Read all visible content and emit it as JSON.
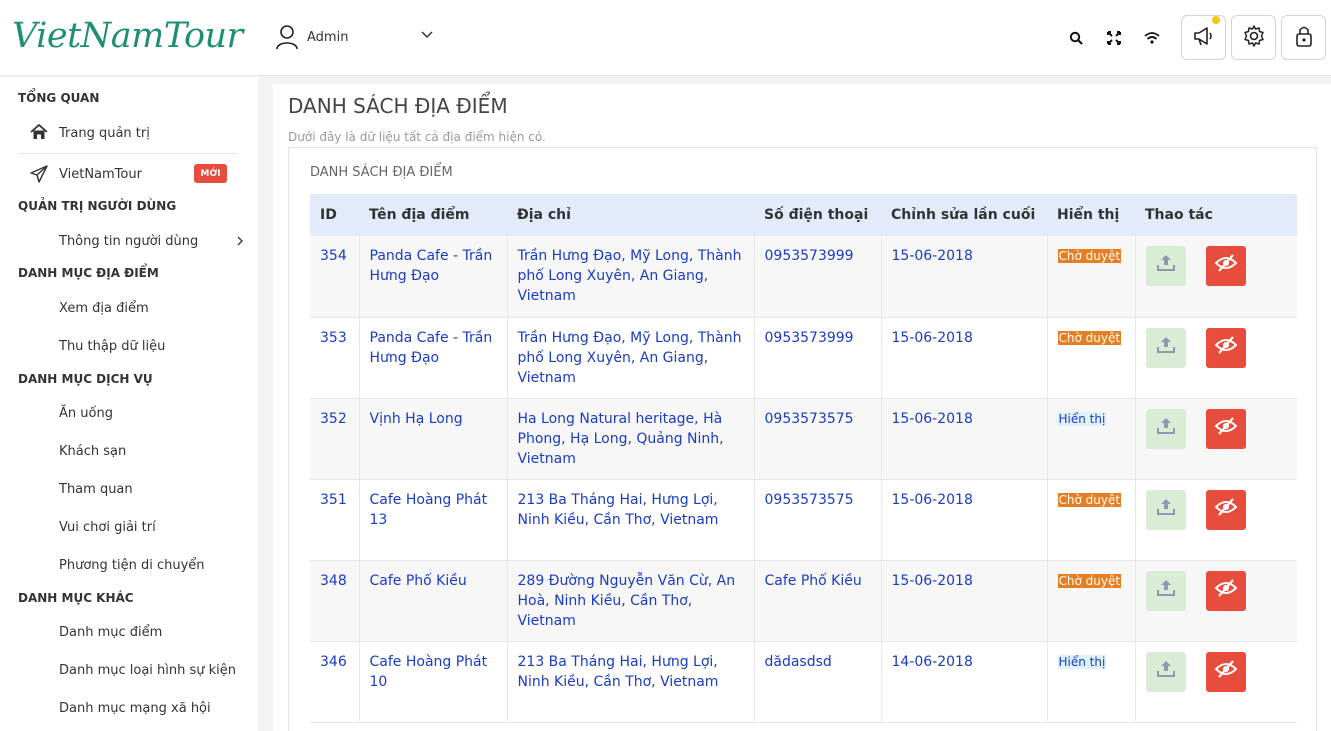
{
  "header": {
    "logo": "VietNamTour",
    "user_name": "Admin",
    "icons": [
      "search-icon",
      "fullscreen-icon",
      "wifi-icon",
      "megaphone-icon",
      "gear-icon",
      "lock-icon"
    ],
    "notification_color": "#f5c518"
  },
  "sidebar": {
    "sections": [
      {
        "title": "TỔNG QUAN"
      },
      {
        "title": "QUẢN TRỊ NGƯỜI DÙNG"
      },
      {
        "title": "DANH MỤC ĐỊA ĐIỂM"
      },
      {
        "title": "DANH MỤC DỊCH VỤ"
      },
      {
        "title": "DANH MỤC KHÁC"
      }
    ],
    "items": [
      {
        "label": "Trang quản trị",
        "icon": "home-icon"
      },
      {
        "label": "VietNamTour",
        "icon": "paper-plane-icon",
        "badge": "MỚI"
      },
      {
        "label": "Thông tin người dùng",
        "icon": "chevron-right-icon"
      },
      {
        "label": "Xem địa điểm"
      },
      {
        "label": "Thu thập dữ liệu"
      },
      {
        "label": "Ăn uống"
      },
      {
        "label": "Khách sạn"
      },
      {
        "label": "Tham quan"
      },
      {
        "label": "Vui chơi giải trí"
      },
      {
        "label": "Phương tiện di chuyển"
      },
      {
        "label": "Danh mục điểm"
      },
      {
        "label": "Danh mục loại hình sự kiện"
      },
      {
        "label": "Danh mục mạng xã hội"
      }
    ]
  },
  "main": {
    "title": "DANH SÁCH ĐỊA ĐIỂM",
    "subtitle": "Dưới đây là dữ liệu tất cả địa điểm hiện có.",
    "panel_title": "DANH SÁCH ĐỊA ĐIỂM",
    "columns": [
      "ID",
      "Tên địa điểm",
      "Địa chỉ",
      "Số điện thoại",
      "Chỉnh sửa lần cuối",
      "Hiển thị",
      "Thao tác"
    ],
    "rows": [
      {
        "id": "354",
        "name": "Panda Cafe - Trần Hưng Đạo",
        "address": "Trần Hưng Đạo, Mỹ Long, Thành phố Long Xuyên, An Giang, Vietnam",
        "phone": "0953573999",
        "updated": "15-06-2018",
        "status": "Chờ duyệt",
        "status_type": "pending"
      },
      {
        "id": "353",
        "name": "Panda Cafe - Trần Hưng Đạo",
        "address": "Trần Hưng Đạo, Mỹ Long, Thành phố Long Xuyên, An Giang, Vietnam",
        "phone": "0953573999",
        "updated": "15-06-2018",
        "status": "Chờ duyệt",
        "status_type": "pending"
      },
      {
        "id": "352",
        "name": "Vịnh Hạ Long",
        "address": "Ha Long Natural heritage, Hà Phong, Hạ Long, Quảng Ninh, Vietnam",
        "phone": "0953573575",
        "updated": "15-06-2018",
        "status": "Hiển thị",
        "status_type": "shown"
      },
      {
        "id": "351",
        "name": "Cafe Hoàng Phát 13",
        "address": "213 Ba Tháng Hai, Hưng Lợi, Ninh Kiều, Cần Thơ, Vietnam",
        "phone": "0953573575",
        "updated": "15-06-2018",
        "status": "Chờ duyệt",
        "status_type": "pending"
      },
      {
        "id": "348",
        "name": "Cafe Phố Kiều",
        "address": "289 Đường Nguyễn Văn Cừ, An Hoà, Ninh Kiều, Cần Thơ, Vietnam",
        "phone": "Cafe Phố Kiều",
        "updated": "15-06-2018",
        "status": "Chờ duyệt",
        "status_type": "pending"
      },
      {
        "id": "346",
        "name": "Cafe Hoàng Phát 10",
        "address": "213 Ba Tháng Hai, Hưng Lợi, Ninh Kiều, Cần Thơ, Vietnam",
        "phone": "dădasdsd",
        "updated": "14-06-2018",
        "status": "Hiển thị",
        "status_type": "shown"
      }
    ],
    "colors": {
      "pending": "#e67e22",
      "shown_bg": "#dff1fb",
      "link": "#1a3cc4",
      "danger": "#e74c3c",
      "success_bg": "#d9ecd6"
    }
  }
}
